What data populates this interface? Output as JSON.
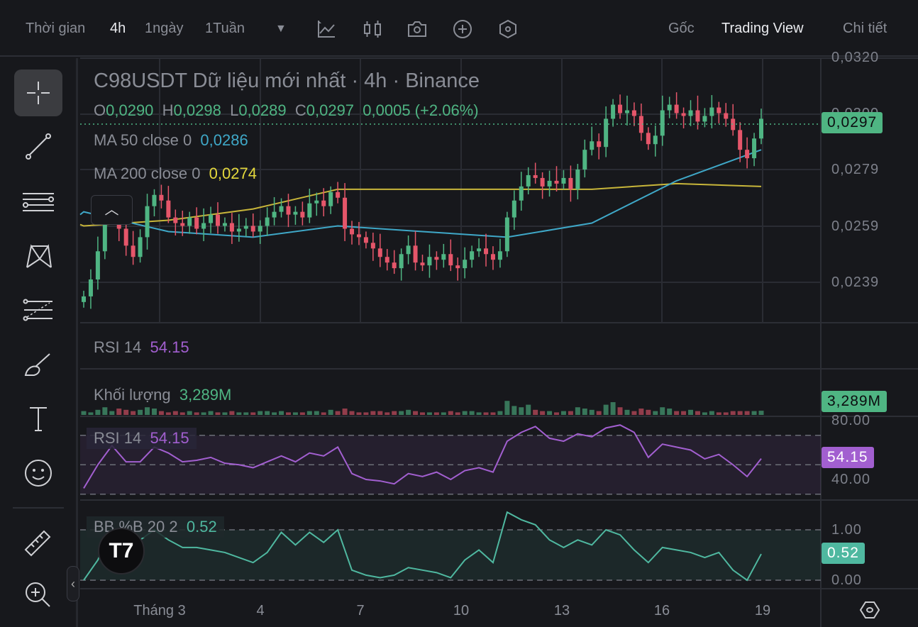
{
  "toolbar": {
    "time_label": "Thời gian",
    "intervals": [
      "4h",
      "1ngày",
      "1Tuần"
    ],
    "active_interval": "4h",
    "dropdown_icon": "triangle-down-icon",
    "icons": [
      "indicator-icon",
      "candle-type-icon",
      "camera-icon",
      "add-circle-icon",
      "settings-hexagon-icon"
    ],
    "views": [
      "Gốc",
      "Trading View",
      "Chi tiết"
    ],
    "active_view": "Trading View"
  },
  "tools": [
    "crosshair-icon",
    "trend-line-icon",
    "fib-lines-icon",
    "pattern-icon",
    "parallel-lines-icon",
    "brush-icon",
    "text-icon",
    "emoji-icon",
    "ruler-icon",
    "zoom-in-icon"
  ],
  "legend": {
    "title": "C98USDT Dữ liệu mới nhất · 4h · Binance",
    "o_label": "O",
    "o": "0,0290",
    "h_label": "H",
    "h": "0,0298",
    "l_label": "L",
    "l": "0,0289",
    "c_label": "C",
    "c": "0,0297",
    "change": "0,0005 (+2.06%)",
    "ma50_label": "MA 50 close 0",
    "ma50": "0,0286",
    "ma200_label": "MA 200 close 0",
    "ma200": "0,0274",
    "rsi_top_label": "RSI 14",
    "rsi_top": "54.15",
    "vol_label": "Khối lượng",
    "vol": "3,289M",
    "rsi_label": "RSI 14",
    "rsi": "54.15",
    "bb_label": "BB %B 20 2",
    "bb": "0.52"
  },
  "price_axis": {
    "ticks": [
      "0,0320",
      "0,0300",
      "0,0279",
      "0,0259",
      "0,0239"
    ],
    "current": "0,0297"
  },
  "volume_axis": {
    "current": "3,289M"
  },
  "rsi_axis": {
    "ticks": [
      "80.00",
      "40.00"
    ],
    "current": "54.15"
  },
  "bb_axis": {
    "ticks": [
      "1.00",
      "0.00"
    ],
    "current": "0.52"
  },
  "time_axis": [
    "Tháng 3",
    "4",
    "7",
    "10",
    "13",
    "16",
    "19"
  ],
  "colors": {
    "up": "#4fb583",
    "down": "#e5566a",
    "ma50": "#3fa8c8",
    "ma200": "#c8b63a",
    "rsi": "#a25fd0",
    "bb": "#4fb8a0",
    "bg": "#17181c"
  },
  "chart_data": {
    "type": "candlestick",
    "title": "C98USDT 4h Binance",
    "ylim": [
      0.0225,
      0.0322
    ],
    "first_open": 0.0232,
    "closes": [
      0.0234,
      0.024,
      0.025,
      0.0262,
      0.0264,
      0.0258,
      0.0252,
      0.0248,
      0.0255,
      0.0266,
      0.027,
      0.0268,
      0.0262,
      0.026,
      0.0259,
      0.0262,
      0.0258,
      0.026,
      0.0263,
      0.0259,
      0.026,
      0.0257,
      0.0258,
      0.0259,
      0.0257,
      0.0259,
      0.0262,
      0.0264,
      0.0266,
      0.0263,
      0.0264,
      0.0262,
      0.0267,
      0.0268,
      0.0266,
      0.0271,
      0.0269,
      0.0258,
      0.0256,
      0.0255,
      0.0253,
      0.0251,
      0.0248,
      0.0246,
      0.0244,
      0.0249,
      0.0252,
      0.0246,
      0.0245,
      0.0248,
      0.0247,
      0.0249,
      0.0245,
      0.0244,
      0.0247,
      0.025,
      0.0251,
      0.0249,
      0.0247,
      0.025,
      0.0262,
      0.0268,
      0.0273,
      0.0277,
      0.0276,
      0.0273,
      0.0275,
      0.0274,
      0.0276,
      0.0272,
      0.0279,
      0.0286,
      0.0289,
      0.0287,
      0.0297,
      0.0302,
      0.0299,
      0.03,
      0.0298,
      0.0292,
      0.0288,
      0.0291,
      0.03,
      0.0302,
      0.0299,
      0.0298,
      0.03,
      0.0296,
      0.0298,
      0.0301,
      0.0299,
      0.0297,
      0.0293,
      0.0286,
      0.0283,
      0.029,
      0.0297
    ],
    "ma50_every12": [
      0.0264,
      0.0257,
      0.0255,
      0.0259,
      0.0257,
      0.0255,
      0.026,
      0.0275,
      0.0286
    ],
    "ma200_every12": [
      0.0259,
      0.0261,
      0.0265,
      0.0272,
      0.0272,
      0.0272,
      0.0272,
      0.0274,
      0.0273
    ],
    "volume_m": [
      3,
      2,
      4,
      6,
      3,
      5,
      4,
      3,
      4,
      6,
      5,
      3,
      2,
      3,
      2,
      3,
      2,
      2,
      3,
      2,
      2,
      3,
      2,
      2,
      2,
      3,
      3,
      2,
      3,
      2,
      2,
      2,
      3,
      3,
      2,
      4,
      3,
      5,
      3,
      2,
      2,
      3,
      3,
      2,
      3,
      3,
      4,
      3,
      2,
      2,
      2,
      2,
      3,
      2,
      3,
      3,
      2,
      2,
      2,
      3,
      11,
      7,
      6,
      8,
      4,
      3,
      3,
      2,
      3,
      3,
      6,
      5,
      4,
      3,
      8,
      10,
      6,
      4,
      3,
      5,
      4,
      3,
      6,
      5,
      3,
      3,
      4,
      3,
      2,
      3,
      2,
      2,
      3,
      3,
      3,
      3,
      3.289
    ],
    "rsi_every2": [
      34,
      50,
      63,
      52,
      52,
      62,
      58,
      52,
      53,
      55,
      51,
      50,
      48,
      52,
      56,
      52,
      58,
      56,
      62,
      44,
      40,
      39,
      37,
      44,
      42,
      45,
      40,
      46,
      48,
      45,
      66,
      72,
      76,
      68,
      66,
      71,
      69,
      75,
      77,
      72,
      55,
      64,
      62,
      60,
      54,
      57,
      50,
      42,
      54.15
    ],
    "rsi_levels": [
      70,
      50,
      30
    ],
    "bb_every2": [
      0.0,
      0.4,
      1.0,
      0.6,
      0.8,
      1.0,
      0.8,
      0.65,
      0.65,
      0.6,
      0.55,
      0.45,
      0.35,
      0.55,
      0.95,
      0.7,
      0.95,
      0.75,
      1.0,
      0.2,
      0.1,
      0.05,
      0.1,
      0.25,
      0.2,
      0.15,
      0.05,
      0.4,
      0.6,
      0.35,
      1.35,
      1.2,
      1.1,
      0.8,
      0.65,
      0.8,
      0.7,
      1.0,
      0.9,
      0.6,
      0.35,
      0.65,
      0.6,
      0.55,
      0.45,
      0.55,
      0.2,
      0.0,
      0.52
    ]
  }
}
